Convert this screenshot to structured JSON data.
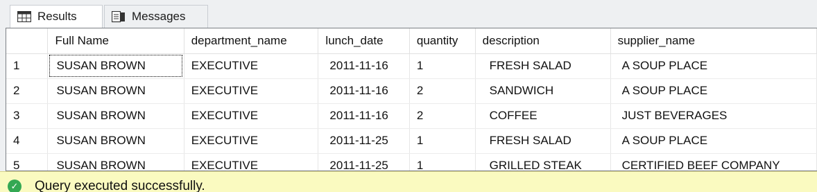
{
  "tabs": [
    {
      "label": "Results",
      "icon": "grid-icon",
      "active": true
    },
    {
      "label": "Messages",
      "icon": "messages-icon",
      "active": false
    }
  ],
  "grid": {
    "columns": [
      "",
      "Full Name",
      "department_name",
      "lunch_date",
      "quantity",
      "description",
      "supplier_name"
    ],
    "rows": [
      {
        "row_number": "1",
        "full_name": "SUSAN BROWN",
        "department_name": "EXECUTIVE",
        "lunch_date": "2011-11-16",
        "quantity": "1",
        "description": "FRESH SALAD",
        "supplier_name": "A SOUP PLACE"
      },
      {
        "row_number": "2",
        "full_name": "SUSAN BROWN",
        "department_name": "EXECUTIVE",
        "lunch_date": "2011-11-16",
        "quantity": "2",
        "description": "SANDWICH",
        "supplier_name": "A SOUP PLACE"
      },
      {
        "row_number": "3",
        "full_name": "SUSAN BROWN",
        "department_name": "EXECUTIVE",
        "lunch_date": "2011-11-16",
        "quantity": "2",
        "description": "COFFEE",
        "supplier_name": "JUST BEVERAGES"
      },
      {
        "row_number": "4",
        "full_name": "SUSAN BROWN",
        "department_name": "EXECUTIVE",
        "lunch_date": "2011-11-25",
        "quantity": "1",
        "description": "FRESH SALAD",
        "supplier_name": "A SOUP PLACE"
      },
      {
        "row_number": "5",
        "full_name": "SUSAN BROWN",
        "department_name": "EXECUTIVE",
        "lunch_date": "2011-11-25",
        "quantity": "1",
        "description": "GRILLED STEAK",
        "supplier_name": "CERTIFIED BEEF COMPANY"
      }
    ]
  },
  "status": {
    "icon": "check-circle-icon",
    "text": "Query executed successfully.",
    "background_color": "#fafac0",
    "icon_color": "#34a853"
  }
}
